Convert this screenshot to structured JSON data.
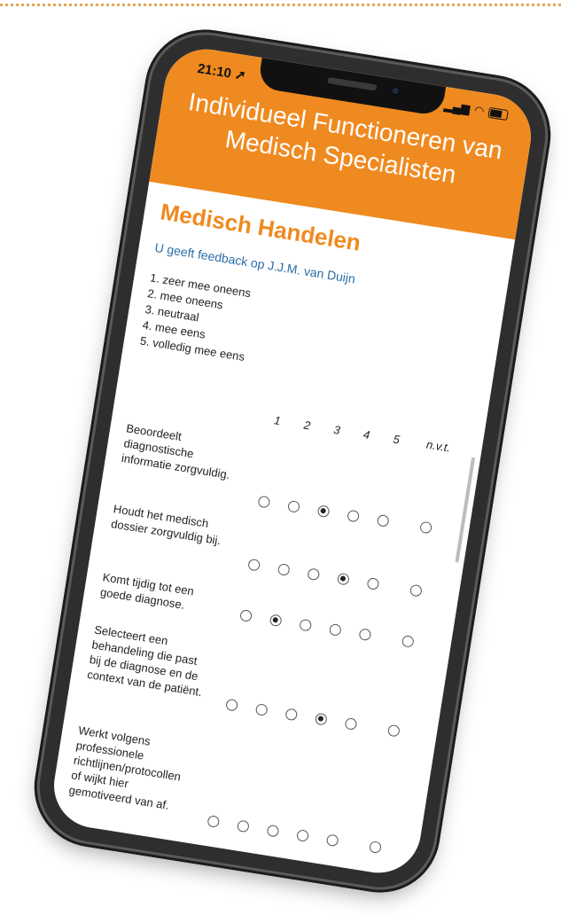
{
  "status_bar": {
    "time": "21:10",
    "location_icon": "location-arrow-icon",
    "signal_icon": "signal-icon",
    "wifi_icon": "wifi-icon",
    "battery_icon": "battery-icon"
  },
  "header": {
    "title": "Individueel Functioneren van Medisch Specialisten",
    "color": "#ef8a20"
  },
  "section": {
    "title": "Medisch Handelen",
    "title_color": "#ef8a20"
  },
  "feedback": {
    "text": "U geeft feedback op J.J.M. van Duijn",
    "color": "#2b6ea8"
  },
  "scale": {
    "options": [
      "1. zeer mee oneens",
      "2. mee oneens",
      "3. neutraal",
      "4. mee eens",
      "5. volledig mee eens"
    ],
    "columns": [
      "1",
      "2",
      "3",
      "4",
      "5",
      "n.v.t."
    ]
  },
  "questions": [
    {
      "text": "Beoordeelt diagnostische informatie zorgvuldig.",
      "selected": "3"
    },
    {
      "text": "Houdt het medisch dossier zorgvuldig bij.",
      "selected": "4"
    },
    {
      "text": "Komt tijdig tot een goede diagnose.",
      "selected": "2"
    },
    {
      "text": "Selecteert een behandeling die past bij de diagnose en de context van de patiënt.",
      "selected": "4"
    },
    {
      "text": "Werkt volgens professionele richtlijnen/protocollen of wijkt hier gemotiveerd van af.",
      "selected": ""
    }
  ]
}
